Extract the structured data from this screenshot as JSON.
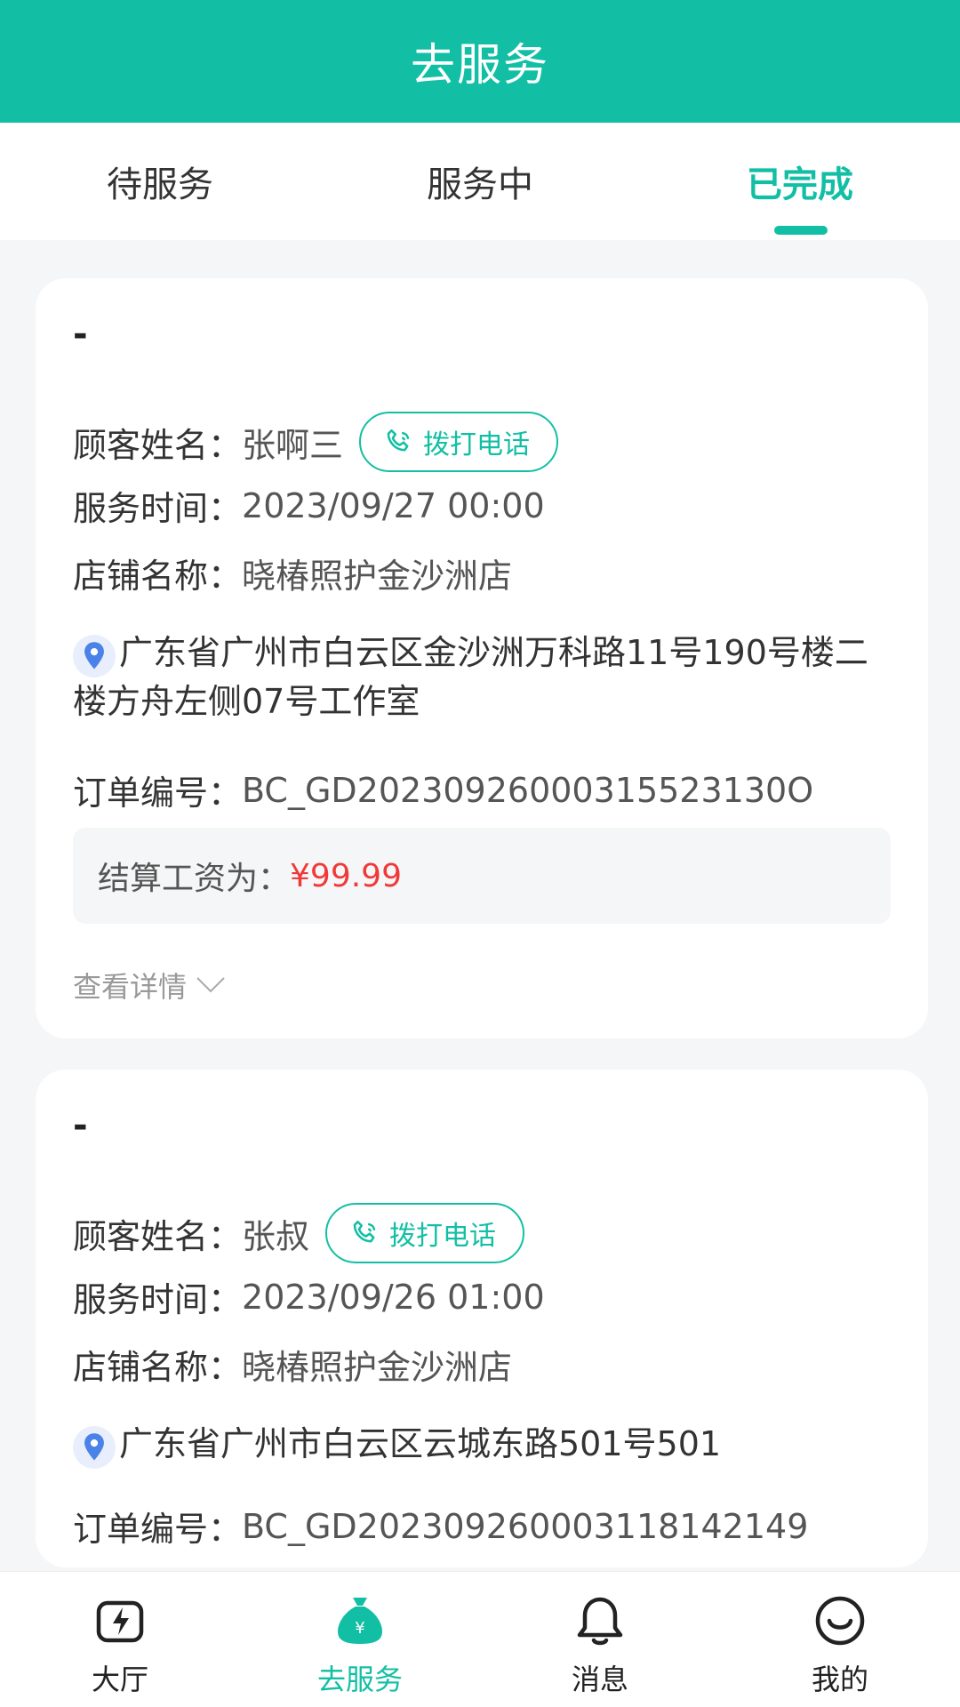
{
  "header": {
    "title": "去服务"
  },
  "tabs": [
    {
      "label": "待服务"
    },
    {
      "label": "服务中"
    },
    {
      "label": "已完成"
    }
  ],
  "orders": [
    {
      "title": "-",
      "customer_label": "顾客姓名：",
      "customer_name": "张啊三",
      "call_label": "拨打电话",
      "time_label": "服务时间：",
      "time_value": "2023/09/27 00:00",
      "store_label": "店铺名称：",
      "store_value": "晓椿照护金沙洲店",
      "address": "广东省广州市白云区金沙洲万科路11号190号楼二楼方舟左侧07号工作室",
      "order_no_label": "订单编号：",
      "order_no_value": "BC_GD20230926000315523130O",
      "settle_label": "结算工资为：",
      "settle_value": "¥99.99",
      "detail_label": "查看详情"
    },
    {
      "title": "-",
      "customer_label": "顾客姓名：",
      "customer_name": "张叔",
      "call_label": "拨打电话",
      "time_label": "服务时间：",
      "time_value": "2023/09/26 01:00",
      "store_label": "店铺名称：",
      "store_value": "晓椿照护金沙洲店",
      "address": "广东省广州市白云区云城东路501号501",
      "order_no_label": "订单编号：",
      "order_no_value": "BC_GD20230926000311814214​9"
    }
  ],
  "tabbar": [
    {
      "label": "大厅",
      "icon": "lightning-icon"
    },
    {
      "label": "去服务",
      "icon": "money-bag-icon"
    },
    {
      "label": "消息",
      "icon": "bell-icon"
    },
    {
      "label": "我的",
      "icon": "smiley-icon"
    }
  ],
  "colors": {
    "accent": "#12bfa4",
    "price": "#f03a3a"
  }
}
